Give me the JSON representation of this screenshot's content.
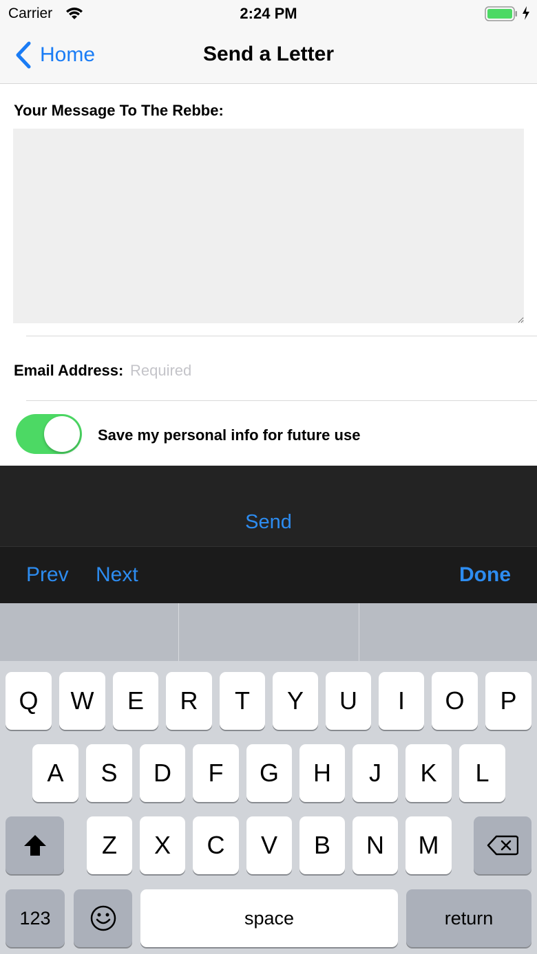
{
  "status_bar": {
    "carrier": "Carrier",
    "time": "2:24 PM",
    "battery_color": "#4cd964"
  },
  "nav": {
    "back_label": "Home",
    "title": "Send a Letter"
  },
  "form": {
    "message_label": "Your Message To The Rebbe:",
    "message_value": "",
    "email_label": "Email Address:",
    "email_placeholder": "Required",
    "save_label": "Save my personal info for future use",
    "save_toggle_on": true
  },
  "send_label": "Send",
  "toolbar": {
    "prev": "Prev",
    "next": "Next",
    "done": "Done"
  },
  "keyboard": {
    "row1": [
      "Q",
      "W",
      "E",
      "R",
      "T",
      "Y",
      "U",
      "I",
      "O",
      "P"
    ],
    "row2": [
      "A",
      "S",
      "D",
      "F",
      "G",
      "H",
      "J",
      "K",
      "L"
    ],
    "row3": [
      "Z",
      "X",
      "C",
      "V",
      "B",
      "N",
      "M"
    ],
    "numbers": "123",
    "space": "space",
    "return": "return",
    "icons": [
      "shift-icon",
      "delete-icon",
      "emoji-icon"
    ]
  },
  "colors": {
    "accent": "#2d8cf0",
    "toggle_on": "#4cd964"
  }
}
